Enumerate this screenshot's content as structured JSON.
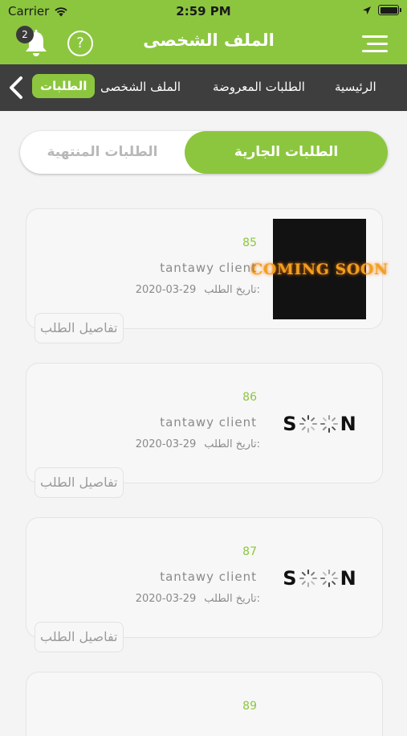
{
  "status_bar": {
    "carrier": "Carrier",
    "time": "2:59 PM"
  },
  "header": {
    "title": "الملف الشخصى",
    "notification_count": "2",
    "help_label": "?"
  },
  "nav": {
    "items": [
      {
        "label": "الرئيسية",
        "active": false
      },
      {
        "label": "الطلبات المعروضة",
        "active": false
      },
      {
        "label": "الملف الشخصى",
        "active": false
      },
      {
        "label": "الطلبات",
        "active": true
      }
    ]
  },
  "tabs": {
    "active": "الطلبات الجارية",
    "inactive": "الطلبات المنتهية"
  },
  "orders": [
    {
      "number": "85",
      "client": "tantawy client",
      "date_label": "تاريخ الطلب:",
      "date": "2020-03-29",
      "details_label": "تفاصيل الطلب",
      "image": "coming-soon-banner",
      "image_text": "COMING SOON"
    },
    {
      "number": "86",
      "client": "tantawy client",
      "date_label": "تاريخ الطلب:",
      "date": "2020-03-29",
      "details_label": "تفاصيل الطلب",
      "image": "soon-logo",
      "image_text": "SN"
    },
    {
      "number": "87",
      "client": "tantawy client",
      "date_label": "تاريخ الطلب:",
      "date": "2020-03-29",
      "details_label": "تفاصيل الطلب",
      "image": "soon-logo",
      "image_text": "SN"
    },
    {
      "number": "89"
    }
  ],
  "colors": {
    "accent": "#8cc63f",
    "nav_bg": "#3e3e3e",
    "card_bg": "#f7f7f7"
  }
}
